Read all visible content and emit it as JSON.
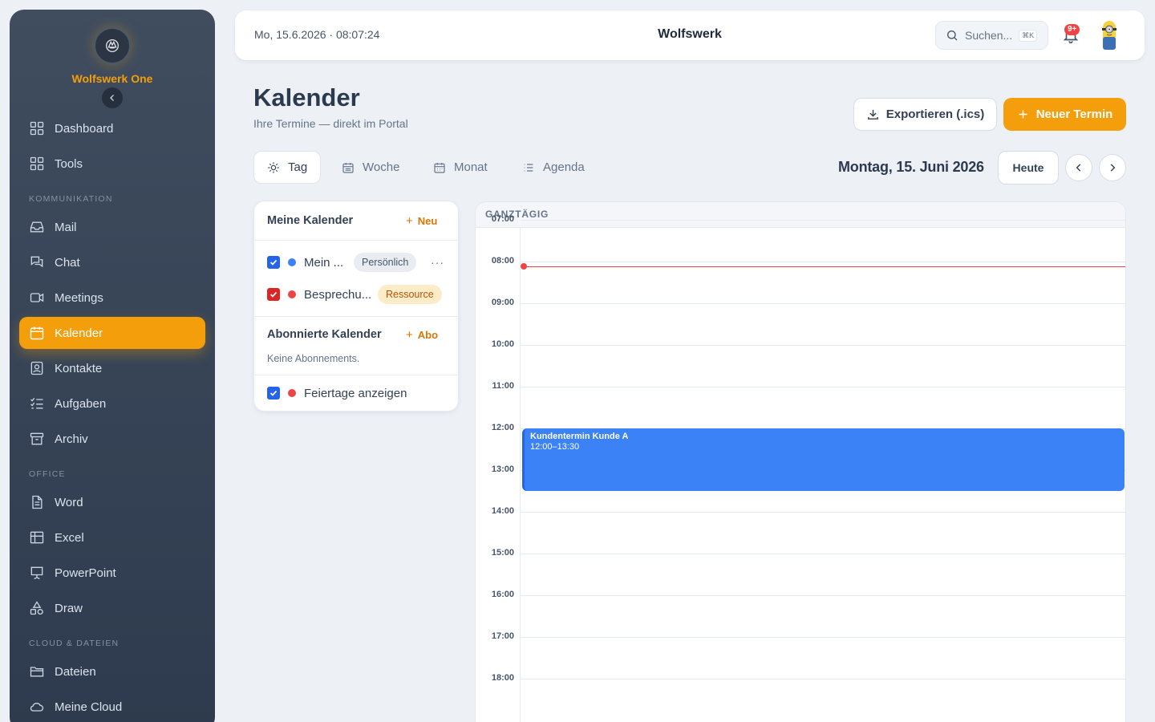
{
  "brand": {
    "name": "Wolfswerk One"
  },
  "sidebar": {
    "items": [
      {
        "label": "Dashboard",
        "icon": "grid-icon"
      },
      {
        "label": "Tools",
        "icon": "grid-icon"
      },
      {
        "label": "Mail",
        "icon": "inbox-icon"
      },
      {
        "label": "Chat",
        "icon": "chat-icon"
      },
      {
        "label": "Meetings",
        "icon": "video-icon"
      },
      {
        "label": "Kalender",
        "icon": "calendar-icon",
        "active": true
      },
      {
        "label": "Kontakte",
        "icon": "contact-icon"
      },
      {
        "label": "Aufgaben",
        "icon": "checklist-icon"
      },
      {
        "label": "Archiv",
        "icon": "archive-icon"
      },
      {
        "label": "Word",
        "icon": "document-icon"
      },
      {
        "label": "Excel",
        "icon": "table-icon"
      },
      {
        "label": "PowerPoint",
        "icon": "presentation-icon"
      },
      {
        "label": "Draw",
        "icon": "shapes-icon"
      },
      {
        "label": "Dateien",
        "icon": "folder-icon"
      },
      {
        "label": "Meine Cloud",
        "icon": "cloud-icon"
      }
    ],
    "sections": [
      "Kommunikation",
      "Office",
      "Cloud & Dateien"
    ]
  },
  "topbar": {
    "datetime": "Mo, 15.6.2026 · 08:07:24",
    "title": "Wolfswerk",
    "search_placeholder": "Suchen...",
    "search_shortcut": "⌘K",
    "notification_badge": "9+"
  },
  "page": {
    "title": "Kalender",
    "subtitle": "Ihre Termine — direkt im Portal",
    "export_label": "Exportieren (.ics)",
    "new_label": "Neuer Termin"
  },
  "views": {
    "tabs": [
      {
        "label": "Tag",
        "active": true
      },
      {
        "label": "Woche"
      },
      {
        "label": "Monat"
      },
      {
        "label": "Agenda"
      }
    ],
    "current_date": "Montag, 15. Juni 2026",
    "today_label": "Heute"
  },
  "calendars": {
    "my_heading": "Meine Kalender",
    "my_add": "Neu",
    "my_items": [
      {
        "name": "Mein ...",
        "badge": "Persönlich",
        "color": "#3b82f6",
        "checked": true
      },
      {
        "name": "Besprechu...",
        "badge": "Ressource",
        "color": "#ef4444",
        "checked": true
      }
    ],
    "subscribed_heading": "Abonnierte Kalender",
    "subscribed_add": "Abo",
    "subscribed_empty": "Keine Abonnements.",
    "holidays_label": "Feiertage anzeigen",
    "holidays_checked": true
  },
  "day_view": {
    "allday_label": "Ganztägig",
    "hours": [
      "07:00",
      "08:00",
      "09:00",
      "10:00",
      "11:00",
      "12:00",
      "13:00",
      "14:00",
      "15:00",
      "16:00",
      "17:00",
      "18:00"
    ],
    "now": "08:07",
    "events": [
      {
        "title": "Kundentermin Kunde A",
        "time": "12:00–13:30",
        "start": "12:00",
        "end": "13:30",
        "color": "#3b82f6"
      }
    ]
  },
  "colors": {
    "accent": "#f59e0b",
    "sidebar": "#34425a",
    "event": "#3b82f6",
    "now": "#ef4444"
  }
}
